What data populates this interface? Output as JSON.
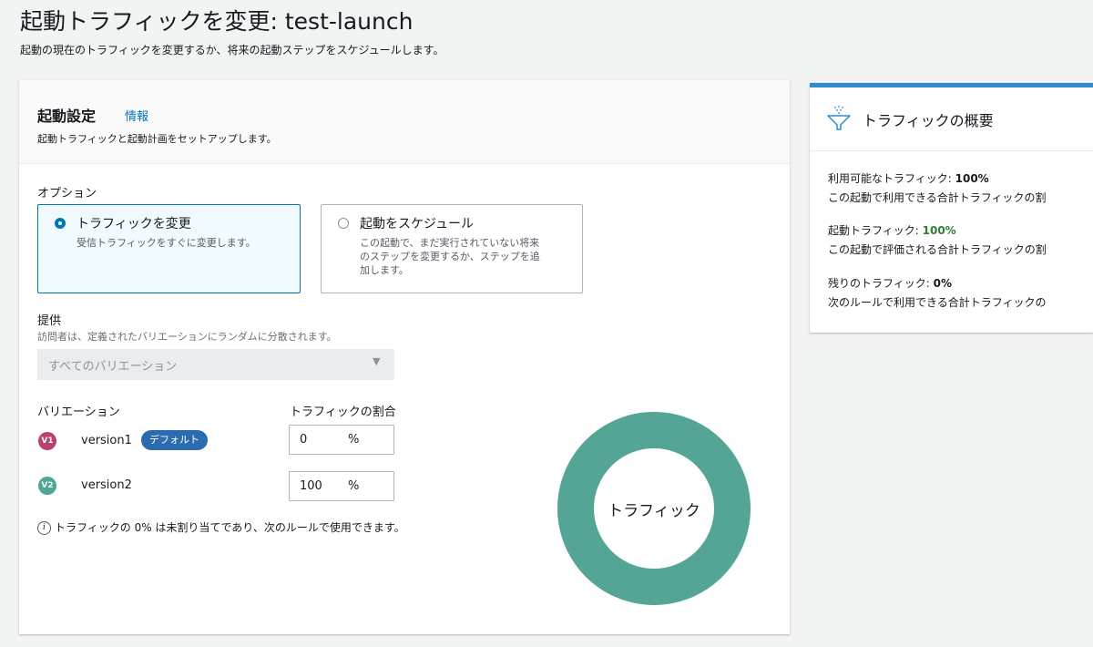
{
  "page": {
    "title": "起動トラフィックを変更: test-launch",
    "subtitle": "起動の現在のトラフィックを変更するか、将来の起動ステップをスケジュールします。"
  },
  "launch_settings": {
    "title": "起動設定",
    "info_link": "情報",
    "description": "起動トラフィックと起動計画をセットアップします。",
    "options_label": "オプション",
    "options": [
      {
        "title": "トラフィックを変更",
        "description": "受信トラフィックをすぐに変更します。",
        "selected": true
      },
      {
        "title": "起動をスケジュール",
        "description_lines": [
          "この起動で、まだ実行されていない将来",
          "のステップを変更するか、ステップを追",
          "加します。"
        ],
        "selected": false
      }
    ],
    "provide_label": "提供",
    "provide_description": "訪問者は、定義されたバリエーションにランダムに分散されます。",
    "provide_select_value": "すべてのバリエーション",
    "variations_header": "バリエーション",
    "traffic_header": "トラフィックの割合",
    "variations": [
      {
        "badge": "V1",
        "name": "version1",
        "pill": "デフォルト",
        "traffic": "0",
        "unit": "%",
        "color": "#b8416d"
      },
      {
        "badge": "V2",
        "name": "version2",
        "traffic": "100",
        "unit": "%",
        "color": "#4fa596"
      }
    ],
    "info_note": "トラフィックの 0% は未割り当てであり、次のルールで使用できます。",
    "donut_label": "トラフィック",
    "donut_color": "#54a596"
  },
  "traffic_summary": {
    "title": "トラフィックの概要",
    "available_label": "利用可能なトラフィック: ",
    "available_value": "100%",
    "available_desc": "この起動で利用できる合計トラフィックの割",
    "launch_label": "起動トラフィック: ",
    "launch_value": "100%",
    "launch_value_color": "#2e7d32",
    "launch_desc": "この起動で評価される合計トラフィックの割",
    "remaining_label": "残りのトラフィック: ",
    "remaining_value": "0%",
    "remaining_desc": "次のルールで利用できる合計トラフィックの"
  }
}
